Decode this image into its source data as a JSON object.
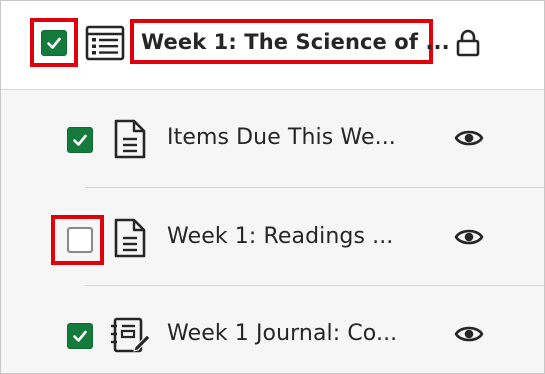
{
  "folder": {
    "title": "Week 1: The Science of ...",
    "checked": true,
    "icon": "folder-content-icon",
    "status_icon": "lock-icon"
  },
  "items": [
    {
      "title": "Items Due This We...",
      "checked": true,
      "icon": "document-icon",
      "status_icon": "visibility-eye-icon"
    },
    {
      "title": "Week 1: Readings ...",
      "checked": false,
      "icon": "document-icon",
      "status_icon": "visibility-eye-icon"
    },
    {
      "title": "Week 1 Journal: Co...",
      "checked": true,
      "icon": "journal-icon",
      "status_icon": "visibility-eye-icon"
    }
  ],
  "colors": {
    "checked": "#147b3d",
    "highlight": "#e0000b",
    "children_background": "#f6f6f6"
  }
}
